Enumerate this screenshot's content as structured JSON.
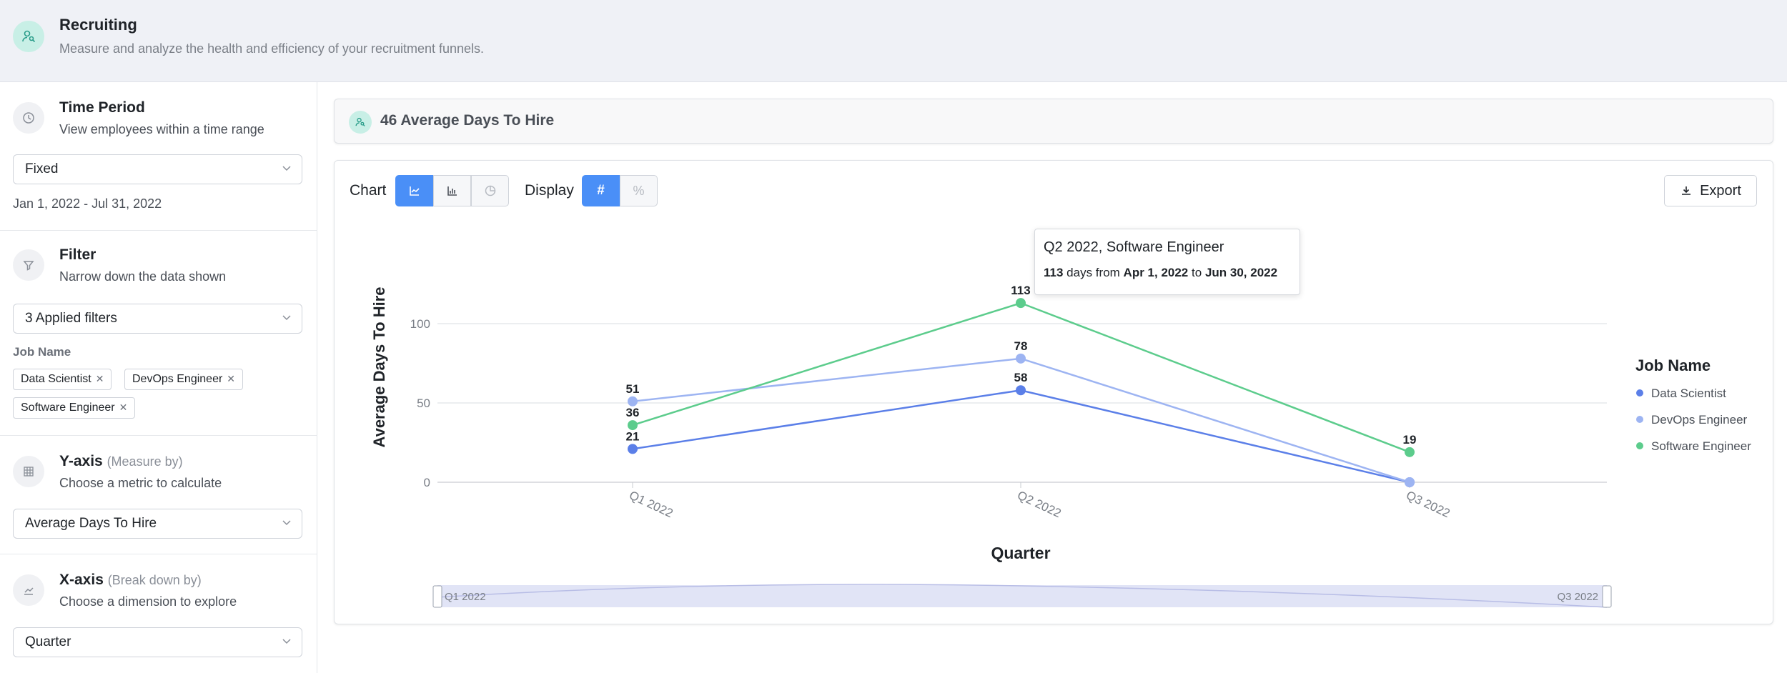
{
  "header": {
    "title": "Recruiting",
    "subtitle": "Measure and analyze the health and efficiency of your recruitment funnels."
  },
  "sidebar": {
    "time_period": {
      "title": "Time Period",
      "desc": "View employees within a time range",
      "select": "Fixed",
      "range": "Jan 1, 2022 - Jul 31, 2022"
    },
    "filter": {
      "title": "Filter",
      "desc": "Narrow down the data shown",
      "select": "3 Applied filters",
      "field_label": "Job Name",
      "chips": [
        "Data Scientist",
        "DevOps Engineer",
        "Software Engineer"
      ]
    },
    "y_axis": {
      "title": "Y-axis",
      "hint": "(Measure by)",
      "desc": "Choose a metric to calculate",
      "select": "Average Days To Hire"
    },
    "x_axis": {
      "title": "X-axis",
      "hint": "(Break down by)",
      "desc": "Choose a dimension to explore",
      "select": "Quarter"
    }
  },
  "banner": {
    "text": "46 Average Days To Hire"
  },
  "controls": {
    "chart_label": "Chart",
    "display_label": "Display",
    "export_label": "Export",
    "chart_types": [
      "line-chart-icon",
      "bar-chart-icon",
      "pie-chart-icon"
    ],
    "display_modes": [
      "#",
      "%"
    ],
    "active_chart": "line",
    "active_display": "#"
  },
  "tooltip": {
    "title": "Q2 2022, Software Engineer",
    "value": "113",
    "mid": "days from",
    "from": "Apr 1, 2022",
    "to_word": "to",
    "to": "Jun 30, 2022"
  },
  "zoom": {
    "start": "Q1 2022",
    "end": "Q3 2022"
  },
  "colors": {
    "data_scientist": "#5b7fe8",
    "devops": "#9db4f2",
    "software": "#5ccc8c",
    "accent": "#4a8ff7"
  },
  "chart_data": {
    "type": "line",
    "xlabel": "Quarter",
    "ylabel": "Average Days To Hire",
    "categories": [
      "Q1 2022",
      "Q2 2022",
      "Q3 2022"
    ],
    "yticks": [
      0,
      50,
      100
    ],
    "ylim": [
      0,
      150
    ],
    "legend_title": "Job Name",
    "legend_position": "right",
    "grid": true,
    "series": [
      {
        "name": "Data Scientist",
        "values": [
          21,
          58,
          0
        ],
        "labels": [
          "21",
          "58",
          ""
        ]
      },
      {
        "name": "DevOps Engineer",
        "values": [
          51,
          78,
          0
        ],
        "labels": [
          "51",
          "78",
          ""
        ]
      },
      {
        "name": "Software Engineer",
        "values": [
          36,
          113,
          19
        ],
        "labels": [
          "36",
          "113",
          "19"
        ]
      }
    ]
  }
}
